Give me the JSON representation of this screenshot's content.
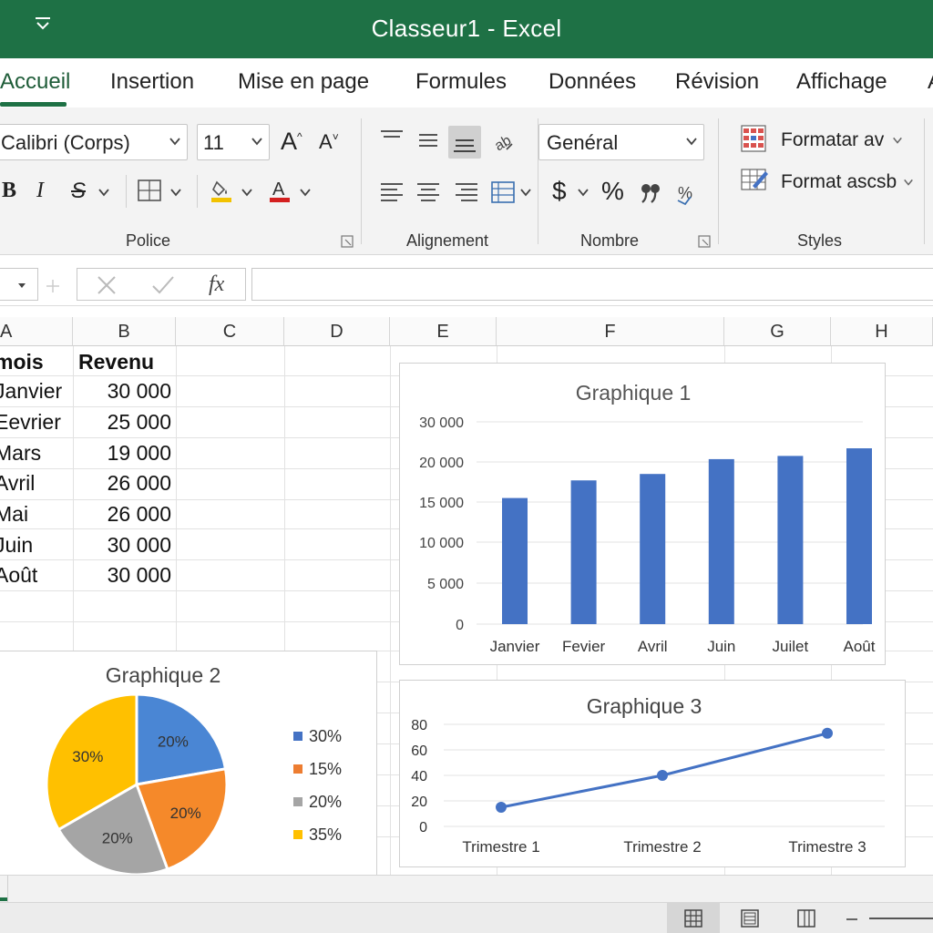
{
  "window": {
    "title": "Classeur1 - Excel"
  },
  "tabs": [
    "Accueil",
    "Insertion",
    "Mise en page",
    "Formules",
    "Données",
    "Révision",
    "Affichage",
    "A"
  ],
  "ribbon": {
    "font_name": "Calibri (Corps)",
    "font_size": "11",
    "grow_label": "A",
    "shrink_label": "A",
    "bold_label": "B",
    "italic_label": "I",
    "strike_label": "S",
    "number_format": "Genéral",
    "dollar_label": "$",
    "percent_label": "%",
    "styles_item1": "Formatar av",
    "styles_item2": "Format ascsb",
    "groups": {
      "font": "Police",
      "alignment": "Alignement",
      "number": "Nombre",
      "styles": "Styles"
    },
    "fill_color": "#f2c200",
    "font_color": "#d42020"
  },
  "formula_bar": {
    "fx_label": "fx"
  },
  "sheet": {
    "columns": [
      "A",
      "B",
      "C",
      "D",
      "E",
      "F",
      "G",
      "H"
    ],
    "header_row": {
      "a": "mois",
      "b": "Revenu"
    },
    "rows": [
      {
        "a": "Janvier",
        "b": "30 000"
      },
      {
        "a": "Eevrier",
        "b": "25 000"
      },
      {
        "a": "Mars",
        "b": "19 000"
      },
      {
        "a": "Avril",
        "b": "26 000"
      },
      {
        "a": "Mai",
        "b": "26 000"
      },
      {
        "a": "Juin",
        "b": "30 000"
      },
      {
        "a": "Août",
        "b": "30 000"
      }
    ]
  },
  "chart_data": [
    {
      "type": "bar",
      "title": "Graphique 1",
      "categories": [
        "Janvier",
        "Fevier",
        "Avril",
        "Juin",
        "Juilet",
        "Août"
      ],
      "values": [
        15500,
        17700,
        18500,
        20700,
        21500,
        23400
      ],
      "ylim": [
        0,
        30000
      ],
      "yticks": [
        0,
        5000,
        10000,
        15000,
        20000,
        30000
      ],
      "ytick_labels": [
        "0",
        "5 000",
        "10 000",
        "15 000",
        "20 000",
        "30 000"
      ],
      "grid": true,
      "color": "#4472c4"
    },
    {
      "type": "pie",
      "title": "Graphique 2",
      "slices": [
        {
          "label": "20%",
          "value": 20,
          "color": "#4a86d4"
        },
        {
          "label": "20%",
          "value": 20,
          "color": "#f5892a"
        },
        {
          "label": "20%",
          "value": 20,
          "color": "#a5a5a5"
        },
        {
          "label": "30%",
          "value": 30,
          "color": "#ffc000"
        }
      ],
      "legend": [
        {
          "label": "30%",
          "color": "#4472c4"
        },
        {
          "label": "15%",
          "color": "#ed7d31"
        },
        {
          "label": "20%",
          "color": "#a5a5a5"
        },
        {
          "label": "35%",
          "color": "#ffc000"
        }
      ],
      "legend_position": "right"
    },
    {
      "type": "line",
      "title": "Graphique 3",
      "categories": [
        "Trimestre 1",
        "Trimestre 2",
        "Trimestre 3"
      ],
      "values": [
        15,
        40,
        73
      ],
      "ylim": [
        0,
        80
      ],
      "yticks": [
        0,
        20,
        40,
        60,
        80
      ],
      "grid": true,
      "color": "#4472c4"
    }
  ]
}
